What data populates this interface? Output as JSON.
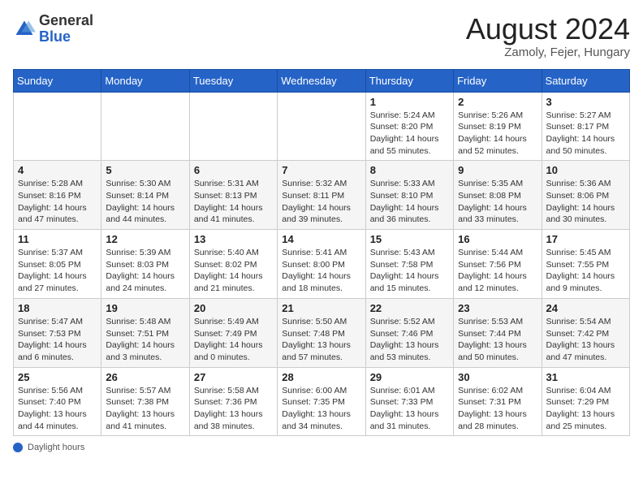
{
  "header": {
    "logo_general": "General",
    "logo_blue": "Blue",
    "title": "August 2024",
    "location": "Zamoly, Fejer, Hungary"
  },
  "days_of_week": [
    "Sunday",
    "Monday",
    "Tuesday",
    "Wednesday",
    "Thursday",
    "Friday",
    "Saturday"
  ],
  "weeks": [
    [
      {
        "day": "",
        "detail": ""
      },
      {
        "day": "",
        "detail": ""
      },
      {
        "day": "",
        "detail": ""
      },
      {
        "day": "",
        "detail": ""
      },
      {
        "day": "1",
        "detail": "Sunrise: 5:24 AM\nSunset: 8:20 PM\nDaylight: 14 hours and 55 minutes."
      },
      {
        "day": "2",
        "detail": "Sunrise: 5:26 AM\nSunset: 8:19 PM\nDaylight: 14 hours and 52 minutes."
      },
      {
        "day": "3",
        "detail": "Sunrise: 5:27 AM\nSunset: 8:17 PM\nDaylight: 14 hours and 50 minutes."
      }
    ],
    [
      {
        "day": "4",
        "detail": "Sunrise: 5:28 AM\nSunset: 8:16 PM\nDaylight: 14 hours and 47 minutes."
      },
      {
        "day": "5",
        "detail": "Sunrise: 5:30 AM\nSunset: 8:14 PM\nDaylight: 14 hours and 44 minutes."
      },
      {
        "day": "6",
        "detail": "Sunrise: 5:31 AM\nSunset: 8:13 PM\nDaylight: 14 hours and 41 minutes."
      },
      {
        "day": "7",
        "detail": "Sunrise: 5:32 AM\nSunset: 8:11 PM\nDaylight: 14 hours and 39 minutes."
      },
      {
        "day": "8",
        "detail": "Sunrise: 5:33 AM\nSunset: 8:10 PM\nDaylight: 14 hours and 36 minutes."
      },
      {
        "day": "9",
        "detail": "Sunrise: 5:35 AM\nSunset: 8:08 PM\nDaylight: 14 hours and 33 minutes."
      },
      {
        "day": "10",
        "detail": "Sunrise: 5:36 AM\nSunset: 8:06 PM\nDaylight: 14 hours and 30 minutes."
      }
    ],
    [
      {
        "day": "11",
        "detail": "Sunrise: 5:37 AM\nSunset: 8:05 PM\nDaylight: 14 hours and 27 minutes."
      },
      {
        "day": "12",
        "detail": "Sunrise: 5:39 AM\nSunset: 8:03 PM\nDaylight: 14 hours and 24 minutes."
      },
      {
        "day": "13",
        "detail": "Sunrise: 5:40 AM\nSunset: 8:02 PM\nDaylight: 14 hours and 21 minutes."
      },
      {
        "day": "14",
        "detail": "Sunrise: 5:41 AM\nSunset: 8:00 PM\nDaylight: 14 hours and 18 minutes."
      },
      {
        "day": "15",
        "detail": "Sunrise: 5:43 AM\nSunset: 7:58 PM\nDaylight: 14 hours and 15 minutes."
      },
      {
        "day": "16",
        "detail": "Sunrise: 5:44 AM\nSunset: 7:56 PM\nDaylight: 14 hours and 12 minutes."
      },
      {
        "day": "17",
        "detail": "Sunrise: 5:45 AM\nSunset: 7:55 PM\nDaylight: 14 hours and 9 minutes."
      }
    ],
    [
      {
        "day": "18",
        "detail": "Sunrise: 5:47 AM\nSunset: 7:53 PM\nDaylight: 14 hours and 6 minutes."
      },
      {
        "day": "19",
        "detail": "Sunrise: 5:48 AM\nSunset: 7:51 PM\nDaylight: 14 hours and 3 minutes."
      },
      {
        "day": "20",
        "detail": "Sunrise: 5:49 AM\nSunset: 7:49 PM\nDaylight: 14 hours and 0 minutes."
      },
      {
        "day": "21",
        "detail": "Sunrise: 5:50 AM\nSunset: 7:48 PM\nDaylight: 13 hours and 57 minutes."
      },
      {
        "day": "22",
        "detail": "Sunrise: 5:52 AM\nSunset: 7:46 PM\nDaylight: 13 hours and 53 minutes."
      },
      {
        "day": "23",
        "detail": "Sunrise: 5:53 AM\nSunset: 7:44 PM\nDaylight: 13 hours and 50 minutes."
      },
      {
        "day": "24",
        "detail": "Sunrise: 5:54 AM\nSunset: 7:42 PM\nDaylight: 13 hours and 47 minutes."
      }
    ],
    [
      {
        "day": "25",
        "detail": "Sunrise: 5:56 AM\nSunset: 7:40 PM\nDaylight: 13 hours and 44 minutes."
      },
      {
        "day": "26",
        "detail": "Sunrise: 5:57 AM\nSunset: 7:38 PM\nDaylight: 13 hours and 41 minutes."
      },
      {
        "day": "27",
        "detail": "Sunrise: 5:58 AM\nSunset: 7:36 PM\nDaylight: 13 hours and 38 minutes."
      },
      {
        "day": "28",
        "detail": "Sunrise: 6:00 AM\nSunset: 7:35 PM\nDaylight: 13 hours and 34 minutes."
      },
      {
        "day": "29",
        "detail": "Sunrise: 6:01 AM\nSunset: 7:33 PM\nDaylight: 13 hours and 31 minutes."
      },
      {
        "day": "30",
        "detail": "Sunrise: 6:02 AM\nSunset: 7:31 PM\nDaylight: 13 hours and 28 minutes."
      },
      {
        "day": "31",
        "detail": "Sunrise: 6:04 AM\nSunset: 7:29 PM\nDaylight: 13 hours and 25 minutes."
      }
    ]
  ],
  "footer": {
    "label": "Daylight hours"
  }
}
